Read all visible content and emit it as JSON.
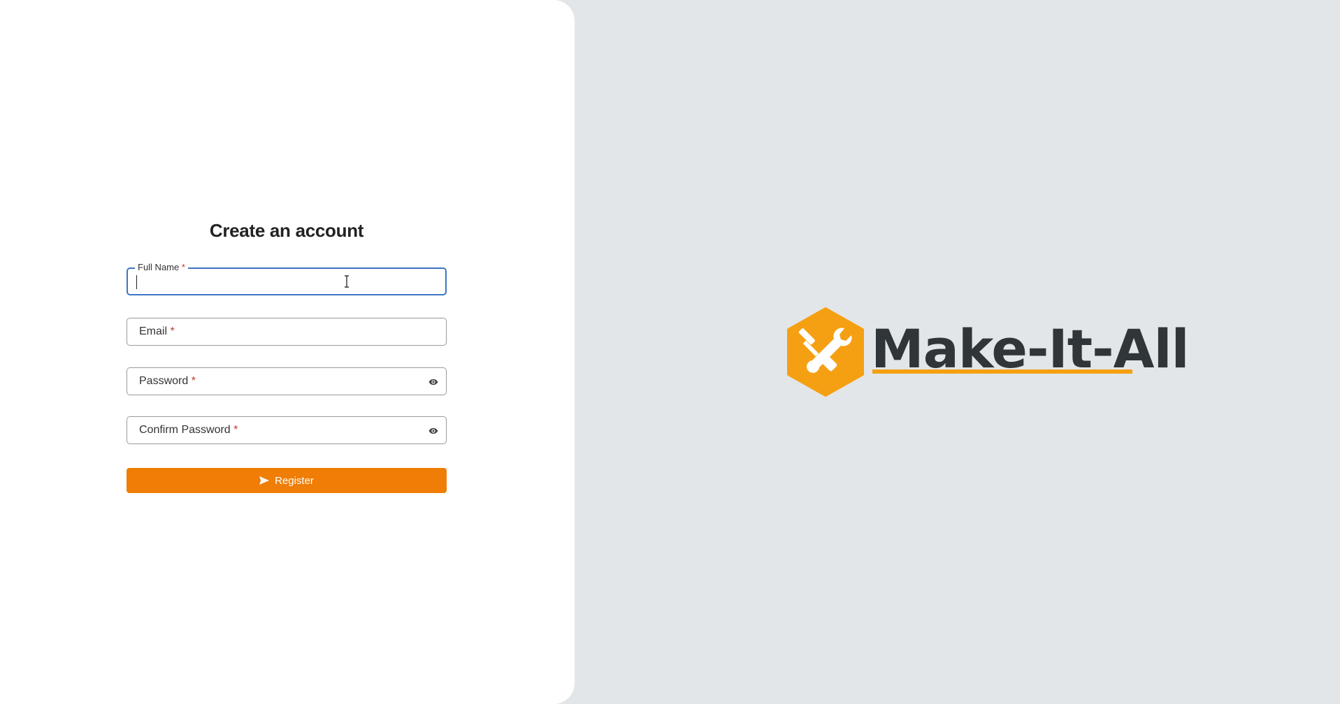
{
  "form": {
    "title": "Create an account",
    "fields": [
      {
        "label": "Full Name",
        "required_mark": "*",
        "value": ""
      },
      {
        "label": "Email",
        "required_mark": "*",
        "value": ""
      },
      {
        "label": "Password",
        "required_mark": "*",
        "value": "",
        "icon": "eye-icon"
      },
      {
        "label": "Confirm Password",
        "required_mark": "*",
        "value": "",
        "icon": "eye-icon"
      }
    ],
    "submit_label": "Register",
    "submit_icon": "send-icon"
  },
  "brand": {
    "name": "Make-It-All",
    "logo_icon": "tools-icon"
  },
  "colors": {
    "accent": "#ef7d06",
    "logo_orange": "#f5a012",
    "focus_border": "#3f74c4",
    "required": "#c0392b",
    "background_right": "#e2e6e9",
    "brand_text": "#2f3538"
  }
}
